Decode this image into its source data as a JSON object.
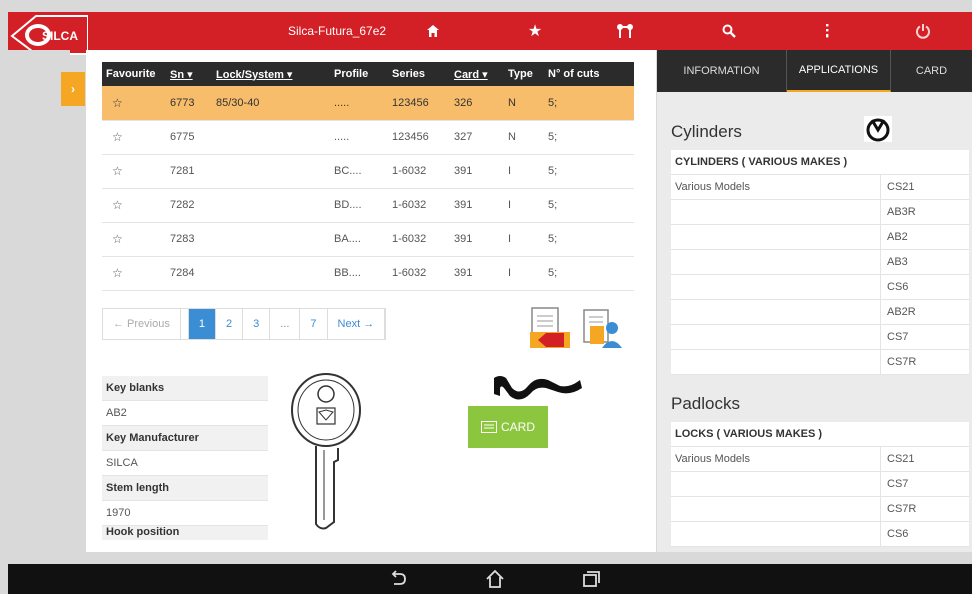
{
  "window": {
    "title": "Silca-Futura_67e2"
  },
  "brand": {
    "logo_text": "SILCA",
    "accent": "#d32027",
    "highlight": "#f8bd6b",
    "orange": "#f5a623",
    "blue": "#3b8dd4",
    "green": "#8cc63f"
  },
  "toolbar": {
    "icons": [
      "home-icon",
      "star-icon",
      "key-pair-icon",
      "search-icon",
      "more-vert-icon",
      "power-icon"
    ]
  },
  "keys_table": {
    "headers": [
      "Favourite",
      "Sn",
      "Lock/System",
      "Profile",
      "Series",
      "Card",
      "Type",
      "N° of cuts"
    ],
    "rows": [
      {
        "fav": "☆",
        "sn": "6773",
        "lock": "85/30-40",
        "profile": ".....",
        "series": "123456",
        "card": "326",
        "type": "N",
        "cuts": "5;"
      },
      {
        "fav": "☆",
        "sn": "6775",
        "lock": "",
        "profile": ".....",
        "series": "123456",
        "card": "327",
        "type": "N",
        "cuts": "5;"
      },
      {
        "fav": "☆",
        "sn": "7281",
        "lock": "",
        "profile": "BC....",
        "series": "1-6032",
        "card": "391",
        "type": "I",
        "cuts": "5;"
      },
      {
        "fav": "☆",
        "sn": "7282",
        "lock": "",
        "profile": "BD....",
        "series": "1-6032",
        "card": "391",
        "type": "I",
        "cuts": "5;"
      },
      {
        "fav": "☆",
        "sn": "7283",
        "lock": "",
        "profile": "BA....",
        "series": "1-6032",
        "card": "391",
        "type": "I",
        "cuts": "5;"
      },
      {
        "fav": "☆",
        "sn": "7284",
        "lock": "",
        "profile": "BB....",
        "series": "1-6032",
        "card": "391",
        "type": "I",
        "cuts": "5;"
      }
    ]
  },
  "pagination": {
    "previous": "← Previous",
    "pages": [
      "1",
      "2",
      "3"
    ],
    "ellipsis": "...",
    "last": "7",
    "next": "Next →"
  },
  "key_properties": [
    {
      "label": "Key blanks",
      "value": "AB2"
    },
    {
      "label": "Key Manufacturer",
      "value": "SILCA"
    },
    {
      "label": "Stem length",
      "value": "1970"
    },
    {
      "label": "Hook position",
      "value": ""
    }
  ],
  "card_button": {
    "label": "CARD"
  },
  "right_tabs": [
    "INFORMATION",
    "APPLICATIONS",
    "CARD"
  ],
  "applications": {
    "cylinders": {
      "title": "Cylinders",
      "group": "CYLINDERS ( VARIOUS MAKES )",
      "rows": [
        {
          "model": "Various Models",
          "code": "CS21"
        },
        {
          "model": "",
          "code": "AB3R"
        },
        {
          "model": "",
          "code": "AB2"
        },
        {
          "model": "",
          "code": "AB3"
        },
        {
          "model": "",
          "code": "CS6"
        },
        {
          "model": "",
          "code": "AB2R"
        },
        {
          "model": "",
          "code": "CS7"
        },
        {
          "model": "",
          "code": "CS7R"
        }
      ]
    },
    "padlocks": {
      "title": "Padlocks",
      "group": "LOCKS ( VARIOUS MAKES )",
      "rows": [
        {
          "model": "Various Models",
          "code": "CS21"
        },
        {
          "model": "",
          "code": "CS7"
        },
        {
          "model": "",
          "code": "CS7R"
        },
        {
          "model": "",
          "code": "CS6"
        }
      ]
    }
  },
  "navbar": {
    "icons": [
      "back-icon",
      "home-outline-icon",
      "recents-icon"
    ]
  }
}
